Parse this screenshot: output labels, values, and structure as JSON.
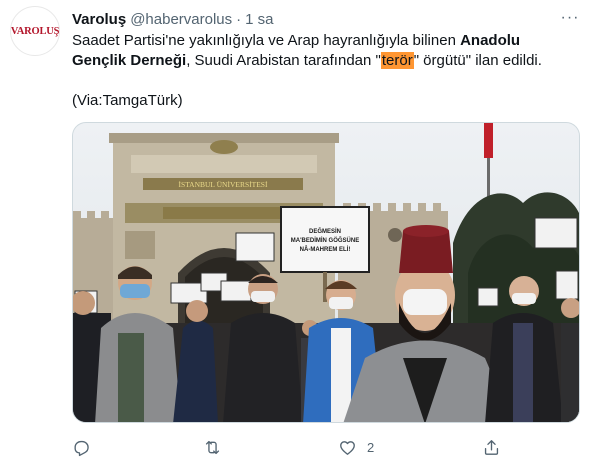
{
  "tweet": {
    "avatar_logo": "VAROLUŞ",
    "display_name": "Varoluş",
    "handle": "@habervarolus",
    "separator": "·",
    "time": "1 sa",
    "more_label": "···",
    "text": {
      "part1": "Saadet Partisi'ne yakınlığıyla ve Arap hayranlığıyla bilinen ",
      "bold": "Anadolu Gençlik Derneği",
      "part2": ", Suudi Arabistan tarafından \"",
      "highlight": "terör",
      "part3": "\" örgütü\" ilan edildi."
    },
    "via": "(Via:TamgaTürk)"
  },
  "media": {
    "gate_sign": "İSTANBUL ÜNİVERSİTESİ",
    "protest_sign_lines": [
      "DEĞMESİN",
      "MA'BEDİMİN GÖĞSÜNE",
      "NÂ-MAHREM ELİ!"
    ]
  },
  "actions": {
    "reply": {
      "icon": "reply-icon",
      "count": ""
    },
    "retweet": {
      "icon": "retweet-icon",
      "count": ""
    },
    "like": {
      "icon": "heart-icon",
      "count": "2"
    },
    "share": {
      "icon": "share-icon",
      "count": ""
    }
  },
  "colors": {
    "text_primary": "#0f1419",
    "text_secondary": "#536471",
    "highlight": "#ff9632",
    "border": "#cfd9de",
    "logo_red": "#b3162b"
  }
}
